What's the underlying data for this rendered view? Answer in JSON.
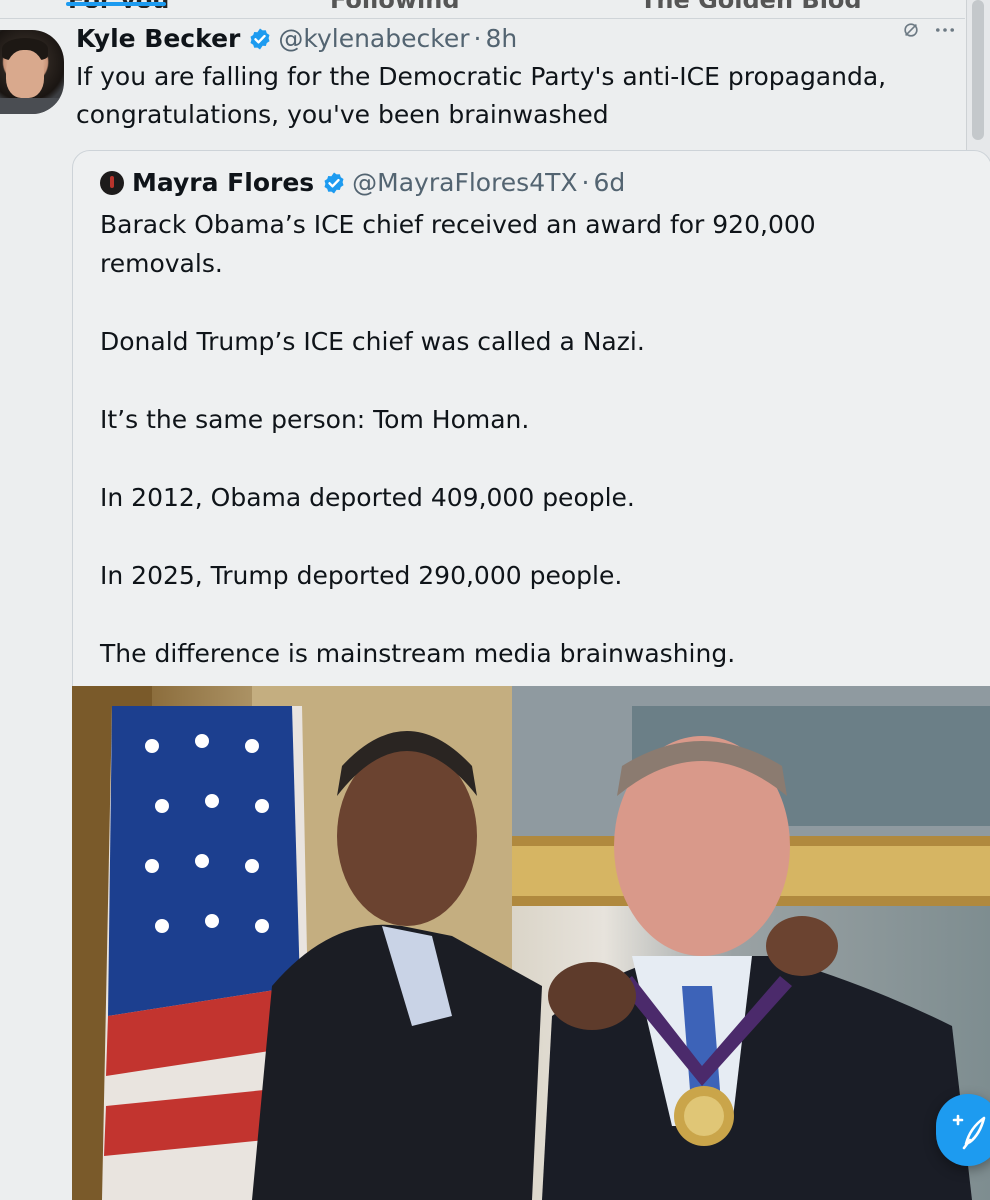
{
  "tabs": [
    {
      "label": "For you",
      "active": true
    },
    {
      "label": "Following",
      "active": false
    },
    {
      "label": "The Golden Blog",
      "active": false
    }
  ],
  "post": {
    "author_name": "Kyle Becker",
    "handle": "@kylenabecker",
    "separator": "·",
    "time": "8h",
    "text_line1": "If you are falling for the Democratic Party's anti-ICE propaganda,",
    "text_line2": "congratulations, you've been brainwashed",
    "verified": true
  },
  "quoted_post": {
    "author_name": "Mayra Flores",
    "handle": "@MayraFlores4TX",
    "separator": "·",
    "time": "6d",
    "verified": true,
    "paragraphs": [
      "Barack Obama’s ICE chief received an award for 920,000 removals.",
      "Donald Trump’s ICE chief was called a Nazi.",
      "It’s the same person: Tom Homan.",
      "In 2012, Obama deported 409,000 people.",
      "In 2025, Trump deported 290,000 people.",
      "The difference is mainstream media brainwashing."
    ]
  },
  "colors": {
    "accent": "#1d9bf0",
    "verified_badge": "#1d9bf0",
    "secondary_text": "#536471"
  },
  "icons": {
    "post_menu": "more-horizontal-icon",
    "grok": "grok-icon",
    "compose": "compose-icon"
  }
}
